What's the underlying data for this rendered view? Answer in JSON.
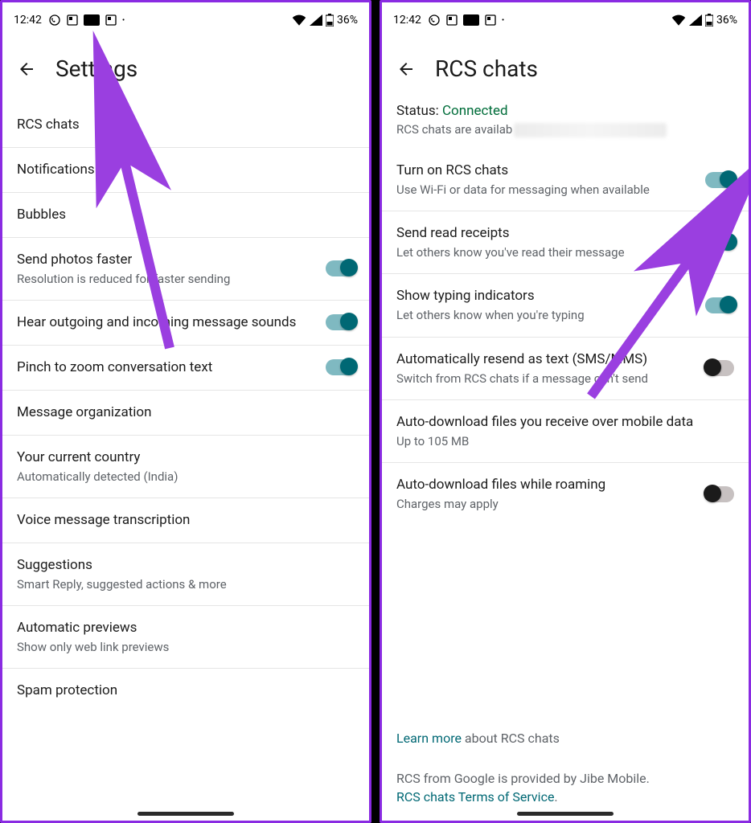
{
  "statusbar": {
    "time": "12:42",
    "battery_text": "36%"
  },
  "left": {
    "header_title": "Settings",
    "rows": [
      {
        "title": "RCS chats",
        "sub": "",
        "toggle": null
      },
      {
        "title": "Notifications",
        "sub": "",
        "toggle": null
      },
      {
        "title": "Bubbles",
        "sub": "",
        "toggle": null
      },
      {
        "title": "Send photos faster",
        "sub": "Resolution is reduced for faster sending",
        "toggle": true
      },
      {
        "title": "Hear outgoing and incoming message sounds",
        "sub": "",
        "toggle": true
      },
      {
        "title": "Pinch to zoom conversation text",
        "sub": "",
        "toggle": true
      },
      {
        "title": "Message organization",
        "sub": "",
        "toggle": null
      },
      {
        "title": "Your current country",
        "sub": "Automatically detected (India)",
        "toggle": null
      },
      {
        "title": "Voice message transcription",
        "sub": "",
        "toggle": null
      },
      {
        "title": "Suggestions",
        "sub": "Smart Reply, suggested actions & more",
        "toggle": null
      },
      {
        "title": "Automatic previews",
        "sub": "Show only web link previews",
        "toggle": null
      },
      {
        "title": "Spam protection",
        "sub": "",
        "toggle": null
      }
    ]
  },
  "right": {
    "header_title": "RCS chats",
    "status_label": "Status: ",
    "status_value": "Connected",
    "status_sub_prefix": "RCS chats are availab",
    "rows": [
      {
        "title": "Turn on RCS chats",
        "sub": "Use Wi-Fi or data for messaging when available",
        "toggle": true
      },
      {
        "title": "Send read receipts",
        "sub": "Let others know you've read their message",
        "toggle": true
      },
      {
        "title": "Show typing indicators",
        "sub": "Let others know when you're typing",
        "toggle": true
      },
      {
        "title": "Automatically resend as text (SMS/MMS)",
        "sub": "Switch from RCS chats if a message can't send",
        "toggle": false
      },
      {
        "title": "Auto-download files you receive over mobile data",
        "sub": "Up to 105 MB",
        "toggle": null
      },
      {
        "title": "Auto-download files while roaming",
        "sub": "Charges may apply",
        "toggle": false
      }
    ],
    "learn_more": "Learn more",
    "learn_more_suffix": " about RCS chats",
    "provider_line": "RCS from Google is provided by Jibe Mobile.",
    "tos_link": "RCS chats Terms of Service",
    "tos_suffix": "."
  }
}
